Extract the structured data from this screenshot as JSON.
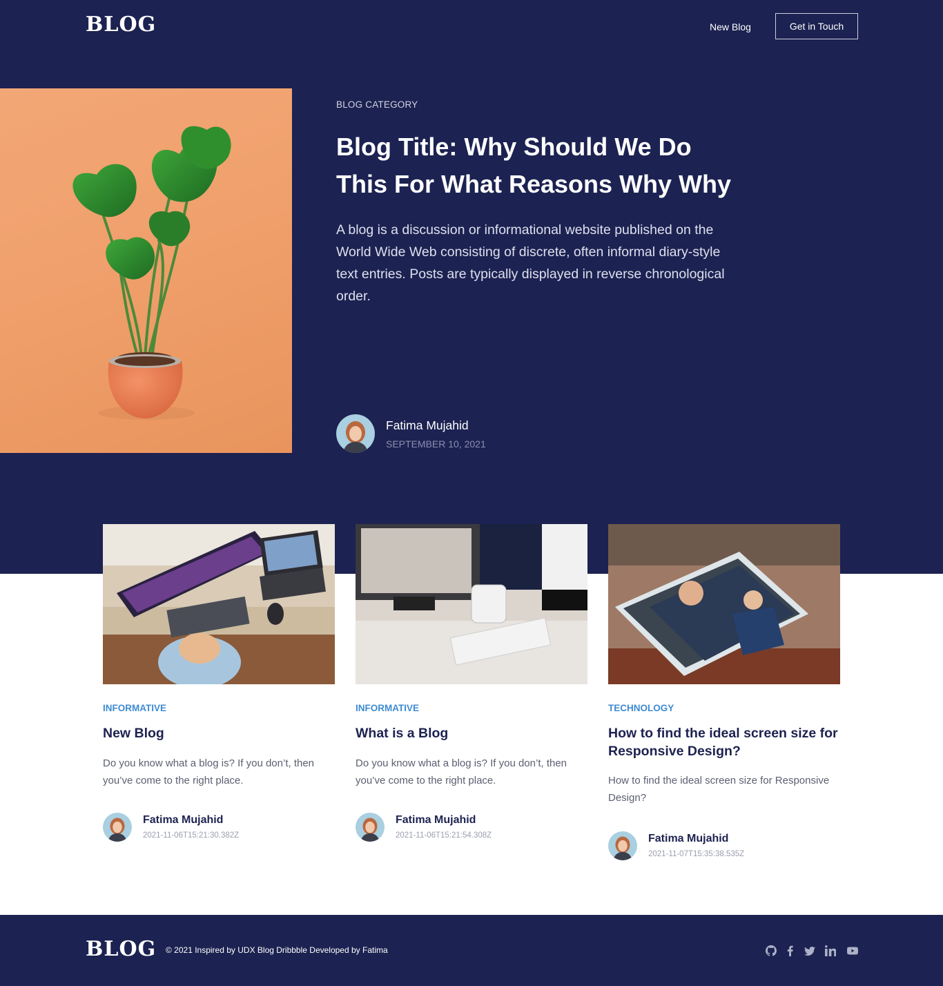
{
  "nav": {
    "logo": "BLOG",
    "new_blog": "New Blog",
    "get_in_touch": "Get in Touch"
  },
  "hero": {
    "category": "BLOG CATEGORY",
    "title": "Blog Title: Why Should We Do This For What Reasons Why Why",
    "description": "A blog is a discussion or informational website published on the World Wide Web consisting of discrete, often informal diary-style text entries. Posts are typically displayed in reverse chronological order.",
    "author": "Fatima Mujahid",
    "date": "SEPTEMBER 10, 2021"
  },
  "cards": [
    {
      "category": "INFORMATIVE",
      "title": "New Blog",
      "description": "Do you know what a blog is? If you don’t, then you’ve come to the right place.",
      "author": "Fatima Mujahid",
      "date": "2021-11-06T15:21:30.382Z"
    },
    {
      "category": "INFORMATIVE",
      "title": "What is a Blog",
      "description": "Do you know what a blog is? If you don’t, then you’ve come to the right place.",
      "author": "Fatima Mujahid",
      "date": "2021-11-06T15:21:54.308Z"
    },
    {
      "category": "TECHNOLOGY",
      "title": "How to find the ideal screen size for Responsive Design?",
      "description": "How to find the ideal screen size for Responsive Design?",
      "author": "Fatima Mujahid",
      "date": "2021-11-07T15:35:38.535Z"
    }
  ],
  "footer": {
    "logo": "BLOG",
    "text": "© 2021 Inspired by UDX Blog Dribbble Developed by Fatima",
    "social_icons": [
      "github-icon",
      "facebook-icon",
      "twitter-icon",
      "linkedin-icon",
      "youtube-icon"
    ]
  },
  "colors": {
    "navy": "#1c2251",
    "accent_blue": "#3d8bd1",
    "hero_bg": "#f0a06c"
  }
}
